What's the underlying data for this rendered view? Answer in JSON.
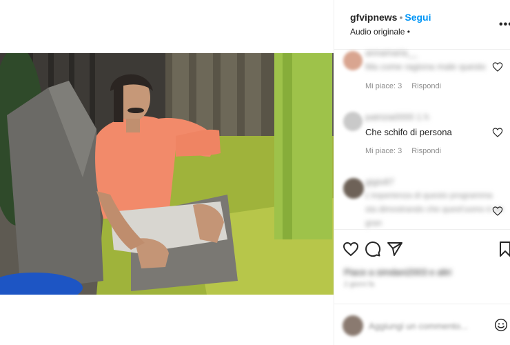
{
  "post": {
    "username": "gfvipnews",
    "separator": "•",
    "follow_label": "Segui",
    "audio_label": "Audio originale •",
    "more_label": "•••"
  },
  "comments": [
    {
      "author": "annamaria__",
      "text": "Ma come ragiona male questo",
      "likes_label": "Mi piace: 3",
      "reply_label": "Rispondi",
      "avatar_color": "#d9a590"
    },
    {
      "author": "patrizia0000 1 h",
      "text": "Che schifo di persona",
      "likes_label": "Mi piace: 3",
      "reply_label": "Rispondi",
      "avatar_color": "#c9c9c9"
    },
    {
      "author": "gigio87",
      "line1": "L'esperienza di questo programma",
      "line2": "sta dimostrando che quest'uomo è un",
      "line3": "gran",
      "avatar_color": "#6e6258"
    }
  ],
  "actions": {
    "like_icon": "heart-icon",
    "comment_icon": "comment-icon",
    "share_icon": "share-icon",
    "save_icon": "bookmark-icon",
    "likes_text": "Piace a simdani2003 e altri",
    "date_text": "2 giorni fa"
  },
  "add_comment": {
    "placeholder": "Aggiungi un commento..."
  },
  "video": {
    "mute_icon": "speaker-muted-icon",
    "shirt_color": "#f28a6a",
    "grass_color": "#a5b83a"
  },
  "colors": {
    "accent": "#0095f6",
    "text": "#262626",
    "muted": "#8e8e8e"
  }
}
